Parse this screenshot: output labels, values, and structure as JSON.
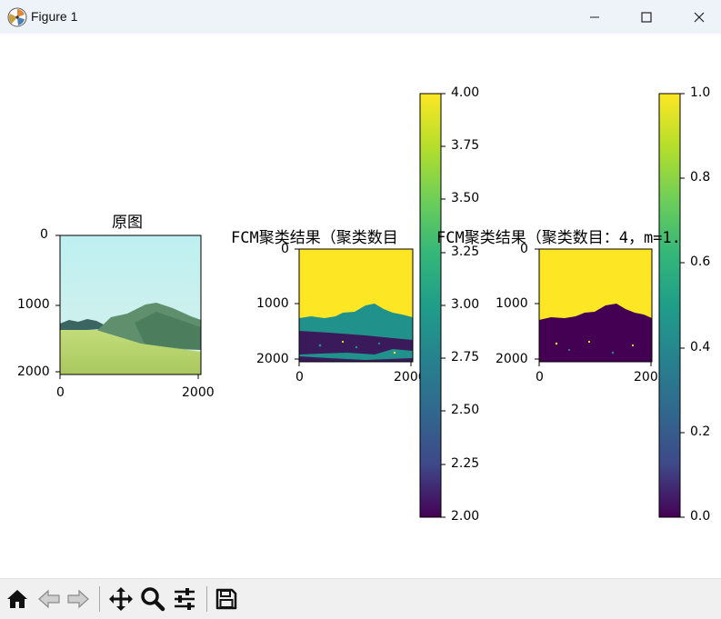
{
  "window": {
    "title": "Figure 1",
    "buttons": [
      "minimize",
      "maximize",
      "close"
    ]
  },
  "figure": {
    "panels": [
      {
        "title": "原图",
        "xticks": [
          "0",
          "2000"
        ],
        "yticks": [
          "0",
          "1000",
          "2000"
        ]
      },
      {
        "title": "FCM聚类结果（聚类数目",
        "xticks": [
          "0",
          "2000"
        ],
        "yticks": [
          "0",
          "1000",
          "2000"
        ],
        "colorbar_ticks": [
          "4.00",
          "3.75",
          "3.50",
          "3.25",
          "3.00",
          "2.75",
          "2.50",
          "2.25",
          "2.00"
        ]
      },
      {
        "title": "FCM聚类结果（聚类数目：4，m=1.",
        "xticks": [
          "0",
          "2000"
        ],
        "yticks": [
          "0",
          "1000",
          "2000"
        ],
        "colorbar_ticks": [
          "1.0",
          "0.8",
          "0.6",
          "0.4",
          "0.2",
          "0.0"
        ]
      }
    ]
  },
  "colors": {
    "viridis_top": "#fde725",
    "viridis_mid": "#21918c",
    "viridis_bottom": "#440154",
    "titlebar_bg": "#eef3f9",
    "toolbar_bg": "#f0f0f0"
  },
  "toolbar": {
    "icons": [
      "home-icon",
      "back-arrow-icon",
      "forward-arrow-icon",
      "pan-icon",
      "zoom-icon",
      "configure-subplots-icon",
      "save-icon"
    ]
  }
}
